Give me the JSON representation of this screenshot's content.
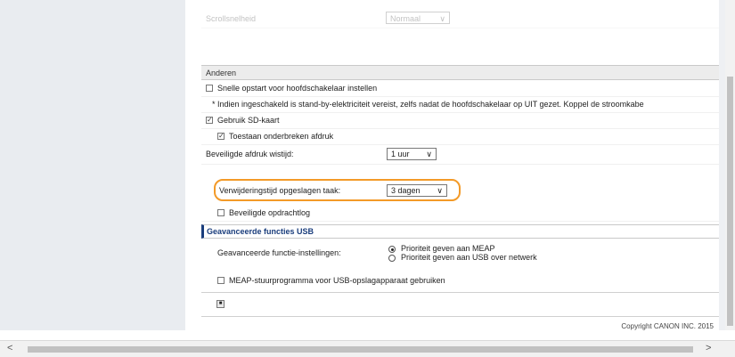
{
  "settings": {
    "scroll_speed": {
      "label": "Scrollsnelheid",
      "value": "Normaal"
    },
    "section_other": "Anderen",
    "quick_startup": {
      "label": "Snelle opstart voor hoofdschakelaar instellen",
      "checked": false
    },
    "note": "* Indien ingeschakeld is stand-by-elektriciteit vereist, zelfs nadat de hoofdschakelaar op UIT gezet. Koppel de stroomkabe",
    "use_sd_card": {
      "label": "Gebruik SD-kaart",
      "checked": true
    },
    "allow_interrupt": {
      "label": "Toestaan onderbreken afdruk",
      "checked": true
    },
    "secure_delete_time": {
      "label": "Beveiligde afdruk wistijd:",
      "value": "1 uur"
    },
    "stored_job_delete_time": {
      "label": "Verwijderingstijd opgeslagen taak:",
      "value": "3 dagen"
    },
    "secure_job_log": {
      "label": "Beveiligde opdrachtlog",
      "checked": false
    },
    "section_usb": "Geavanceerde functies USB",
    "usb_function_settings": {
      "label": "Geavanceerde functie-instellingen:",
      "options": [
        "Prioriteit geven aan MEAP",
        "Prioriteit geven aan USB over netwerk"
      ],
      "selected_index": 0
    },
    "meap_driver": {
      "label": "MEAP-stuurprogramma voor USB-opslagapparaat gebruiken",
      "checked": false
    }
  },
  "footer": {
    "copyright": "Copyright CANON INC. 2015"
  },
  "scrollbar": {
    "left_arrow": "<",
    "right_arrow": ">"
  },
  "icons": {
    "collapse": "collapse-icon",
    "checkmark": "✓",
    "chevron": "∨"
  }
}
